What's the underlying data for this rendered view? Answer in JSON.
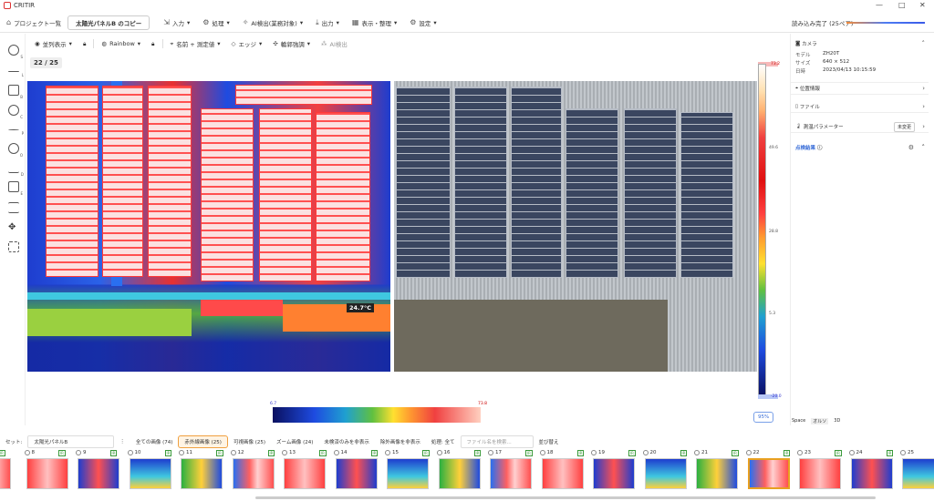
{
  "app": {
    "title": "CRITIR"
  },
  "menubar": {
    "project_list": "プロジェクト一覧",
    "project_tab": "太陽光パネルB のコピー",
    "input": "入力",
    "process": "処理",
    "ai": "AI検出(業務対象)",
    "output": "出力",
    "view": "表示・整理",
    "settings": "設定"
  },
  "status": {
    "loading": "読み込み完了 (25ペア)",
    "progress": 1.0
  },
  "viewbar": {
    "parallel": "並列表示",
    "palette": "Rainbow",
    "name_measure": "名前 + 測定値",
    "edge": "エッジ",
    "contour": "輪郭強調",
    "ai": "AI検出"
  },
  "counter": "22 / 25",
  "thermal": {
    "temp": "24.7°C"
  },
  "scale": {
    "max": "73.2",
    "t1": "49.6",
    "t2": "28.8",
    "t3": "5.3",
    "min": "-20.0",
    "zoom": "95%"
  },
  "histogram": {
    "min": "6.7",
    "max": "73.8"
  },
  "right_panel": {
    "camera": "カメラ",
    "model_label": "モデル",
    "model": "ZH20T",
    "size_label": "サイズ",
    "size": "640 × 512",
    "date_label": "日時",
    "date": "2023/04/13 10:15:59",
    "position": "位置情報",
    "file": "ファイル",
    "params": "測温パラメーター",
    "unchanged": "未変更",
    "results": "点検結果",
    "tabs": [
      "Space",
      "オルソ",
      "3D"
    ]
  },
  "bottombar": {
    "set_label": "セット:",
    "set": "太陽光パネルB",
    "all": "全ての画像 (74)",
    "ir": "赤外線画像 (25)",
    "vis": "可視画像 (25)",
    "zoom": "ズーム画像 (24)",
    "hide_unselected": "未検済のみを非表示",
    "hide_excluded": "除外画像を非表示",
    "filter": "処理: 全て",
    "search": "ファイル名を検索...",
    "sort": "並び替え"
  },
  "thumbs": [
    "",
    "8",
    "9",
    "10",
    "11",
    "12",
    "13",
    "14",
    "15",
    "16",
    "17",
    "18",
    "19",
    "20",
    "21",
    "22",
    "23",
    "24",
    "25"
  ],
  "selected_thumb": "22"
}
